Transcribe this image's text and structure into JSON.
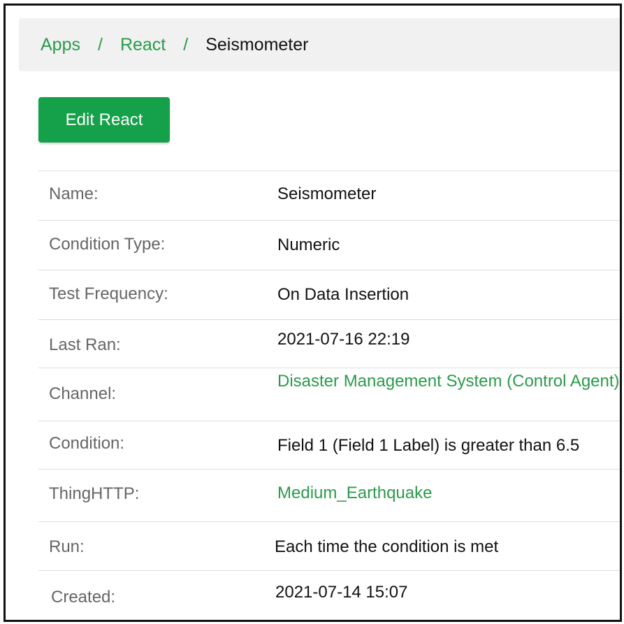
{
  "breadcrumb": {
    "items": [
      "Apps",
      "React"
    ],
    "separator": "/",
    "current": "Seismometer"
  },
  "edit_button": {
    "label": "Edit React"
  },
  "details": [
    {
      "label": "Name:",
      "value": "Seismometer"
    },
    {
      "label": "Condition Type:",
      "value": "Numeric"
    },
    {
      "label": "Test Frequency:",
      "value": "On Data Insertion"
    },
    {
      "label": "Last Ran:",
      "value": "2021-07-16   22:19"
    },
    {
      "label": "Channel:",
      "value": "Disaster Management System (Control Agent)"
    },
    {
      "label": "Condition:",
      "value": "Field 1 (Field 1 Label) is greater than 6.5"
    },
    {
      "label": "ThingHTTP:",
      "value": "Medium_Earthquake"
    },
    {
      "label": "Run:",
      "value": "Each time the condition is met"
    },
    {
      "label": "Created:",
      "value": "2021-07-14   15:07"
    }
  ],
  "colors": {
    "accent": "#15a04a",
    "link": "#2b9a4b",
    "label": "#666666",
    "text": "#111111",
    "breadcrumb_bg": "#f1f1f1",
    "row_border": "#dddddd"
  }
}
